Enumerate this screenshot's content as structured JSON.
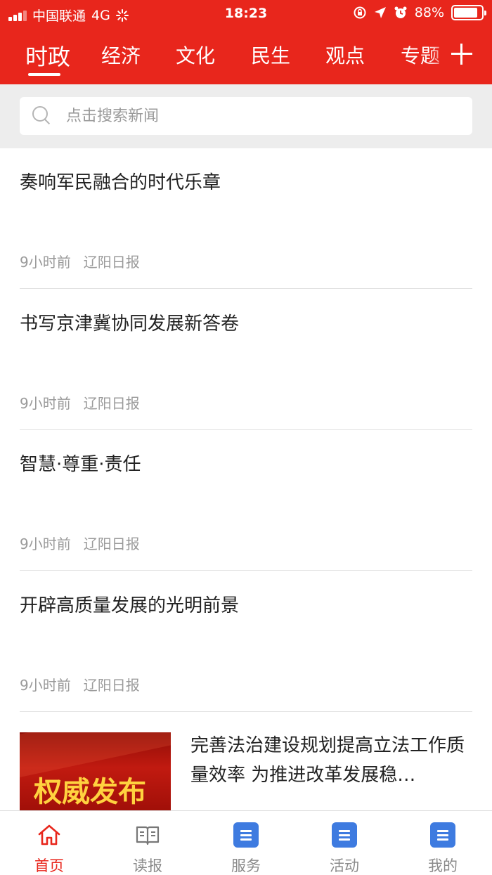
{
  "status_bar": {
    "carrier": "中国联通",
    "network": "4G",
    "time": "18:23",
    "battery": "88%",
    "battery_level": 0.88
  },
  "channels": {
    "tabs": [
      "时政",
      "经济",
      "文化",
      "民生",
      "观点",
      "专题"
    ],
    "active_index": 0
  },
  "search": {
    "placeholder": "点击搜索新闻"
  },
  "news": [
    {
      "title": "奏响军民融合的时代乐章",
      "time": "9小时前",
      "source": "辽阳日报"
    },
    {
      "title": "书写京津冀协同发展新答卷",
      "time": "9小时前",
      "source": "辽阳日报"
    },
    {
      "title": "智慧·尊重·责任",
      "time": "9小时前",
      "source": "辽阳日报"
    },
    {
      "title": "开辟高质量发展的光明前景",
      "time": "9小时前",
      "source": "辽阳日报"
    }
  ],
  "featured": {
    "thumb_text": "权威发布",
    "title": "完善法治建设规划提高立法工作质量效率 为推进改革发展稳…"
  },
  "bottom_nav": [
    {
      "label": "首页",
      "icon": "home-icon"
    },
    {
      "label": "读报",
      "icon": "book-icon"
    },
    {
      "label": "服务",
      "icon": "document-icon"
    },
    {
      "label": "活动",
      "icon": "document-icon"
    },
    {
      "label": "我的",
      "icon": "document-icon"
    }
  ],
  "colors": {
    "brand": "#e8261c",
    "nav_icon": "#3e7be0",
    "meta_text": "#9a9a9a"
  }
}
